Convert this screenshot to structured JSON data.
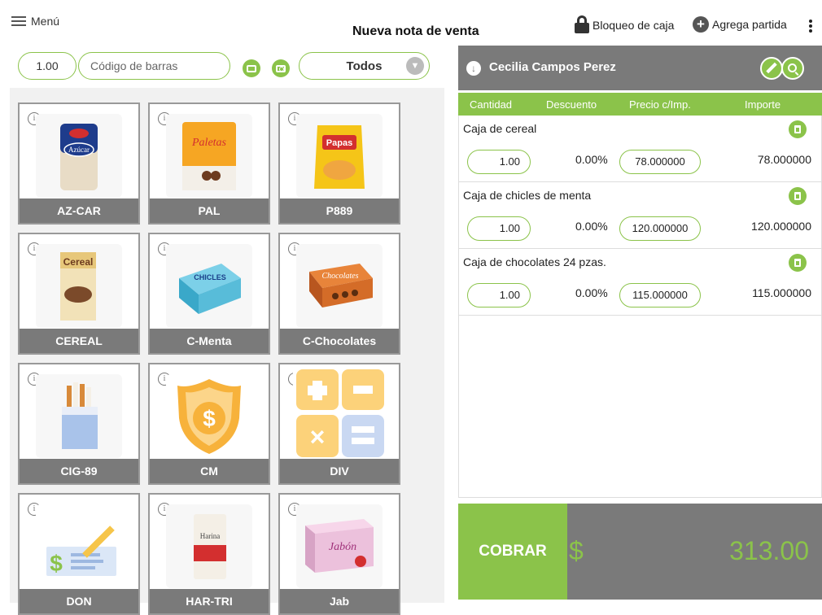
{
  "header": {
    "menu_label": "Menú",
    "title": "Nueva nota de venta",
    "lock_label": "Bloqueo de caja",
    "add_item_label": "Agrega partida"
  },
  "toolbar": {
    "quantity": "1.00",
    "barcode_placeholder": "Código de barras",
    "category_selected": "Todos"
  },
  "products": [
    {
      "code": "AZ-CAR",
      "icon": "sugar-bag-icon"
    },
    {
      "code": "PAL",
      "icon": "lollipop-bag-icon"
    },
    {
      "code": "P889",
      "icon": "chips-bag-icon"
    },
    {
      "code": "CEREAL",
      "icon": "cereal-box-icon"
    },
    {
      "code": "C-Menta",
      "icon": "gum-box-icon"
    },
    {
      "code": "C-Chocolates",
      "icon": "chocolate-box-icon"
    },
    {
      "code": "CIG-89",
      "icon": "cigarette-pack-icon"
    },
    {
      "code": "CM",
      "icon": "dollar-shield-icon"
    },
    {
      "code": "DIV",
      "icon": "calculator-icon"
    },
    {
      "code": "DON",
      "icon": "donation-icon"
    },
    {
      "code": "HAR-TRI",
      "icon": "flour-bag-icon"
    },
    {
      "code": "Jab",
      "icon": "soap-box-icon"
    }
  ],
  "product_images": {
    "AZ-CAR": "Azúcar",
    "PAL": "Paletas",
    "P889": "Papas",
    "CEREAL": "Cereal",
    "C-Menta": "CHICLES",
    "C-Chocolates": "Chocolates",
    "HAR-TRI": "Harina",
    "Jab": "Jabón"
  },
  "customer": {
    "name": "Cecilia Campos Perez"
  },
  "columns": {
    "quantity": "Cantidad",
    "discount": "Descuento",
    "price": "Precio c/Imp.",
    "amount": "Importe"
  },
  "lines": [
    {
      "description": "Caja de cereal",
      "quantity": "1.00",
      "discount": "0.00%",
      "price": "78.000000",
      "amount": "78.000000"
    },
    {
      "description": "Caja de chicles de menta",
      "quantity": "1.00",
      "discount": "0.00%",
      "price": "120.000000",
      "amount": "120.000000"
    },
    {
      "description": "Caja de chocolates 24 pzas.",
      "quantity": "1.00",
      "discount": "0.00%",
      "price": "115.000000",
      "amount": "115.000000"
    }
  ],
  "payment": {
    "charge_label": "COBRAR",
    "currency_symbol": "$",
    "total": "313.00"
  },
  "colors": {
    "accent_green": "#8bc34a",
    "panel_gray": "#7a7a7a"
  }
}
